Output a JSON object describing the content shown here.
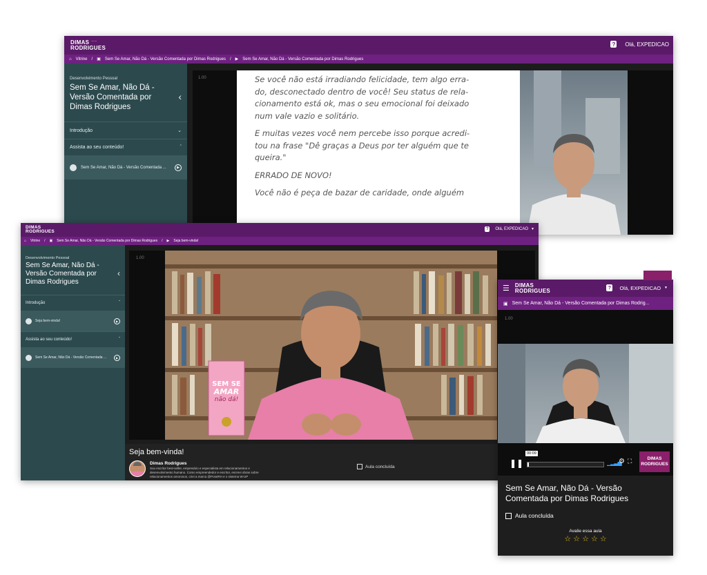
{
  "app": {
    "logo_line1": "DIMAS",
    "logo_line2": "RODRIGUES",
    "greeting": "Olá, EXPEDICAO",
    "help_icon": "question-icon",
    "home_icon": "home-icon"
  },
  "back_window": {
    "breadcrumbs": [
      "Vitrine",
      "/",
      "Sem Se Amar, Não Dá - Versão Comentada por Dimas Rodrigues",
      "/",
      "Sem Se Amar, Não Dá - Versão Comentada por Dimas Rodrigues"
    ],
    "sidebar": {
      "category": "Desenvolvimento Pessoal",
      "title": "Sem Se Amar, Não Dá - Versão Comentada por Dimas Rodrigues",
      "sections": [
        {
          "label": "Introdução",
          "chevron": "chevron-down-icon"
        },
        {
          "label": "Assista ao seu conteúdo!",
          "chevron": "chevron-up-icon"
        }
      ],
      "item": "Sem Se Amar, Não Dá - Versão Comentada ..."
    },
    "speed": "1.00",
    "book_text": [
      "Se você não está irradiando felicidade, tem algo erra-",
      "do, desconectado dentro de você! Seu status de rela-",
      "cionamento está ok, mas o seu emocional foi deixado",
      "num vale vazio e solitário.",
      "",
      "E muitas vezes você nem percebe isso porque acredi-",
      "tou na frase \"Dê graças a Deus por ter alguém que te",
      "queira.\"",
      "",
      "ERRADO DE NOVO!",
      "",
      "Você não é peça de bazar de caridade, onde alguém"
    ]
  },
  "mid_window": {
    "breadcrumbs": [
      "Vitrine",
      "/",
      "Sem Se Amar, Não Dá - Versão Comentada por Dimas Rodrigues",
      "/",
      "Seja bem-vinda!"
    ],
    "sidebar": {
      "category": "Desenvolvimento Pessoal",
      "title": "Sem Se Amar, Não Dá - Versão Comentada por Dimas Rodrigues",
      "sections": [
        {
          "label": "Introdução",
          "chevron": "chevron-up-icon"
        },
        {
          "label": "Assista ao seu conteúdo!",
          "chevron": "chevron-up-icon"
        }
      ],
      "items": [
        "Seja bem-vinda!",
        "Sem Se Amar, Não Dá - Versão Comentada ..."
      ]
    },
    "speed": "1.00",
    "book_cover": {
      "line1": "SEM SE",
      "line2": "AMAR",
      "line3": "não dá!"
    },
    "lesson_title": "Seja bem-vinda!",
    "author_name": "Dimas Rodrigues",
    "author_bio": "Sou escritor best-seller, empresário e especialista em relacionamentos e desenvolvimento humano. Como empreendedor e escritor, escrevi obras sobre relacionamentos amorosos, criei a marca @PoseRH e o sistema W-UP",
    "completed_label": "Aula concluída"
  },
  "mobile": {
    "breadcrumb": "Sem Se Amar, Não Dá - Versão Comentada por Dimas Rodrig...",
    "speed": "1.00",
    "time": "00:09",
    "progress": 0.02,
    "title": "Sem Se Amar, Não Dá - Versão Comentada por Dimas Rodrigues",
    "completed_label": "Aula concluída",
    "rate_label": "Avalie essa aula",
    "stars": "☆ ☆ ☆ ☆ ☆",
    "colors": {
      "brand": "#5a1a68",
      "brand_light": "#6e2180",
      "star": "#f0c419"
    }
  }
}
